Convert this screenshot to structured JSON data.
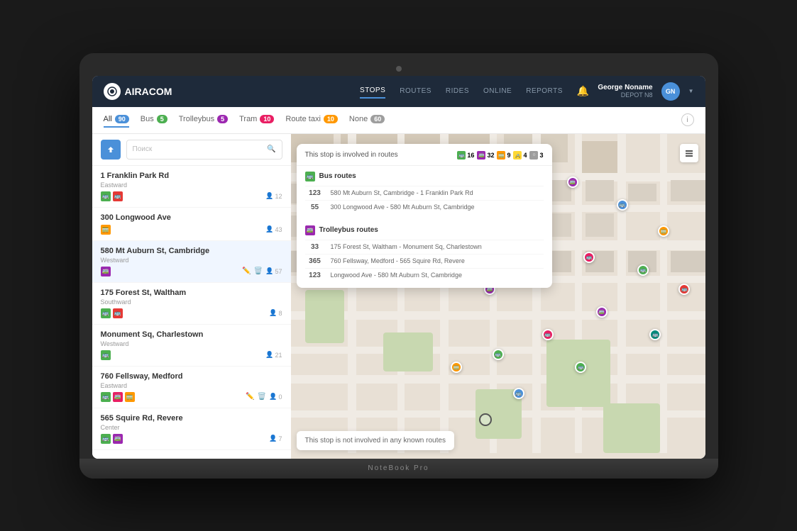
{
  "laptop": {
    "model_label": "NoteBook Pro"
  },
  "header": {
    "logo_text": "AIRACOM",
    "nav_items": [
      {
        "label": "STOPS",
        "active": true
      },
      {
        "label": "ROUTES",
        "active": false
      },
      {
        "label": "RIDES",
        "active": false
      },
      {
        "label": "ONLINE",
        "active": false
      },
      {
        "label": "REPORTS",
        "active": false
      }
    ],
    "user_name": "George Noname",
    "user_depot": "DEPOT N8",
    "notification_label": "🔔"
  },
  "filter_tabs": [
    {
      "label": "All",
      "badge": "90",
      "badge_color": "badge-blue",
      "active": true
    },
    {
      "label": "Bus",
      "badge": "5",
      "badge_color": "badge-green",
      "active": false
    },
    {
      "label": "Trolleybus",
      "badge": "5",
      "badge_color": "badge-purple",
      "active": false
    },
    {
      "label": "Tram",
      "badge": "10",
      "badge_color": "badge-pink",
      "active": false
    },
    {
      "label": "Route taxi",
      "badge": "10",
      "badge_color": "badge-orange",
      "active": false
    },
    {
      "label": "None",
      "badge": "60",
      "badge_color": "badge-gray",
      "active": false
    }
  ],
  "sidebar": {
    "search_placeholder": "Поиск",
    "stops": [
      {
        "name": "1 Franklin Park Rd",
        "direction": "Eastward",
        "icons": [
          "bus-green",
          "bus-red"
        ],
        "count": "12",
        "has_edit": false
      },
      {
        "name": "300 Longwood Ave",
        "direction": "",
        "icons": [
          "tram-orange"
        ],
        "count": "43",
        "has_edit": false
      },
      {
        "name": "580 Mt Auburn St, Cambridge",
        "direction": "Westward",
        "icons": [
          "troll-blue"
        ],
        "count": "57",
        "has_edit": true,
        "selected": true
      },
      {
        "name": "175 Forest St, Waltham",
        "direction": "Southward",
        "icons": [
          "bus-green",
          "bus-red"
        ],
        "count": "8",
        "has_edit": false
      },
      {
        "name": "Monument Sq, Charlestown",
        "direction": "Westward",
        "icons": [
          "bus-green"
        ],
        "count": "21",
        "has_edit": false
      },
      {
        "name": "760 Fellsway, Medford",
        "direction": "Eastward",
        "icons": [
          "bus-green",
          "bus-pink",
          "tram-orange"
        ],
        "count": "0",
        "has_edit": true
      },
      {
        "name": "565 Squire Rd, Revere",
        "direction": "Center",
        "icons": [
          "bus-green",
          "troll-blue"
        ],
        "count": "7",
        "has_edit": false
      }
    ]
  },
  "route_popup": {
    "title": "This stop is involved in routes",
    "counts": [
      {
        "icon": "bus",
        "count": "16"
      },
      {
        "icon": "trolley",
        "count": "32"
      },
      {
        "icon": "tram",
        "count": "9"
      },
      {
        "icon": "taxi",
        "count": "4"
      },
      {
        "icon": "none",
        "count": "3"
      }
    ],
    "bus_section_title": "Bus routes",
    "bus_routes": [
      {
        "num": "123",
        "desc": "580 Mt Auburn St, Cambridge - 1 Franklin Park Rd"
      },
      {
        "num": "55",
        "desc": "300 Longwood Ave - 580 Mt Auburn St, Cambridge"
      }
    ],
    "trolley_section_title": "Trolleybus routes",
    "trolley_routes": [
      {
        "num": "33",
        "desc": "175 Forest St, Waltham - Monument Sq, Charlestown"
      },
      {
        "num": "365",
        "desc": "760 Fellsway, Medford - 565 Squire Rd, Revere"
      },
      {
        "num": "123",
        "desc": "Longwood Ave - 580 Mt Auburn St, Cambridge"
      }
    ]
  },
  "not_involved_popup": {
    "text": "This stop is not involved in any known routes"
  },
  "map_controls": {
    "layers_label": "⊞"
  }
}
